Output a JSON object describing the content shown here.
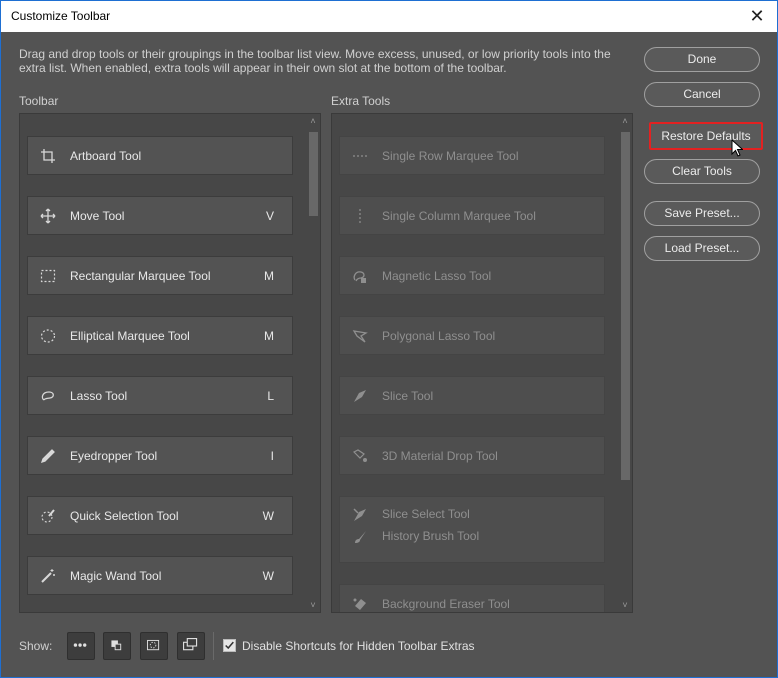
{
  "window": {
    "title": "Customize Toolbar",
    "close_glyph": "✕"
  },
  "description": "Drag and drop tools or their groupings in the toolbar list view. Move excess, unused, or low priority tools into the extra list. When enabled, extra tools will appear in their own slot at the bottom of the toolbar.",
  "toolbar": {
    "label": "Toolbar",
    "items": [
      {
        "label": "Artboard Tool",
        "key": "",
        "icon": "artboard-icon"
      },
      {
        "label": "Move Tool",
        "key": "V",
        "icon": "move-icon"
      },
      {
        "label": "Rectangular Marquee Tool",
        "key": "M",
        "icon": "rect-marquee-icon"
      },
      {
        "label": "Elliptical Marquee Tool",
        "key": "M",
        "icon": "ellipse-marquee-icon"
      },
      {
        "label": "Lasso Tool",
        "key": "L",
        "icon": "lasso-icon"
      },
      {
        "label": "Eyedropper Tool",
        "key": "I",
        "icon": "eyedropper-icon"
      },
      {
        "label": "Quick Selection Tool",
        "key": "W",
        "icon": "quick-selection-icon"
      },
      {
        "label": "Magic Wand Tool",
        "key": "W",
        "icon": "magic-wand-icon"
      }
    ]
  },
  "extra": {
    "label": "Extra Tools",
    "items": [
      {
        "label": "Single Row Marquee Tool",
        "icon": "single-row-icon"
      },
      {
        "label": "Single Column Marquee Tool",
        "icon": "single-column-icon"
      },
      {
        "label": "Magnetic Lasso Tool",
        "icon": "magnetic-lasso-icon"
      },
      {
        "label": "Polygonal Lasso Tool",
        "icon": "polygonal-lasso-icon"
      },
      {
        "label": "Slice Tool",
        "icon": "slice-icon"
      },
      {
        "label": "3D Material Drop Tool",
        "icon": "material-drop-icon"
      },
      {
        "label": "Slice Select Tool",
        "icon": "slice-select-icon"
      },
      {
        "label": "History Brush Tool",
        "icon": "history-brush-icon"
      },
      {
        "label": "Background Eraser Tool",
        "icon": "background-eraser-icon"
      }
    ]
  },
  "buttons": {
    "done": "Done",
    "cancel": "Cancel",
    "restore": "Restore Defaults",
    "clear": "Clear Tools",
    "save_preset": "Save Preset...",
    "load_preset": "Load Preset..."
  },
  "footer": {
    "show_label": "Show:",
    "checkbox_label": "Disable Shortcuts for Hidden Toolbar Extras",
    "checkbox_checked": true
  }
}
